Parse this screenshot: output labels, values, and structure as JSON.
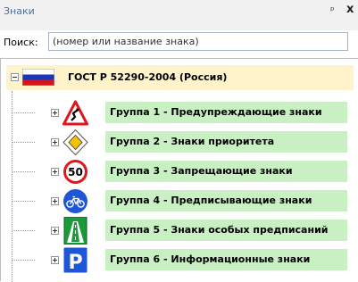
{
  "panel": {
    "title": "Знаки",
    "pin_glyph": "ᵮ",
    "close_glyph": "x"
  },
  "search": {
    "label": "Поиск:",
    "placeholder": "(номер или название знака)"
  },
  "tree": {
    "root": {
      "label": "ГОСТ Р 52290-2004 (Россия)",
      "icon": "russia-flag-icon"
    },
    "groups": [
      {
        "label": "Группа 1 - Предупреждающие знаки",
        "icon": "warning-sign-icon"
      },
      {
        "label": "Группа 2 - Знаки приоритета",
        "icon": "priority-road-icon"
      },
      {
        "label": "Группа 3 - Запрещающие знаки",
        "icon": "speed-limit-icon",
        "icon_text": "50"
      },
      {
        "label": "Группа 4 - Предписывающие знаки",
        "icon": "bicycle-path-icon"
      },
      {
        "label": "Группа 5 - Знаки особых предписаний",
        "icon": "motorway-icon"
      },
      {
        "label": "Группа 6 - Информационные знаки",
        "icon": "parking-icon",
        "icon_text": "P"
      }
    ]
  },
  "colors": {
    "title": "#4e70a0",
    "root_highlight": "#fff3cc",
    "group_highlight": "#c9f0c3"
  }
}
